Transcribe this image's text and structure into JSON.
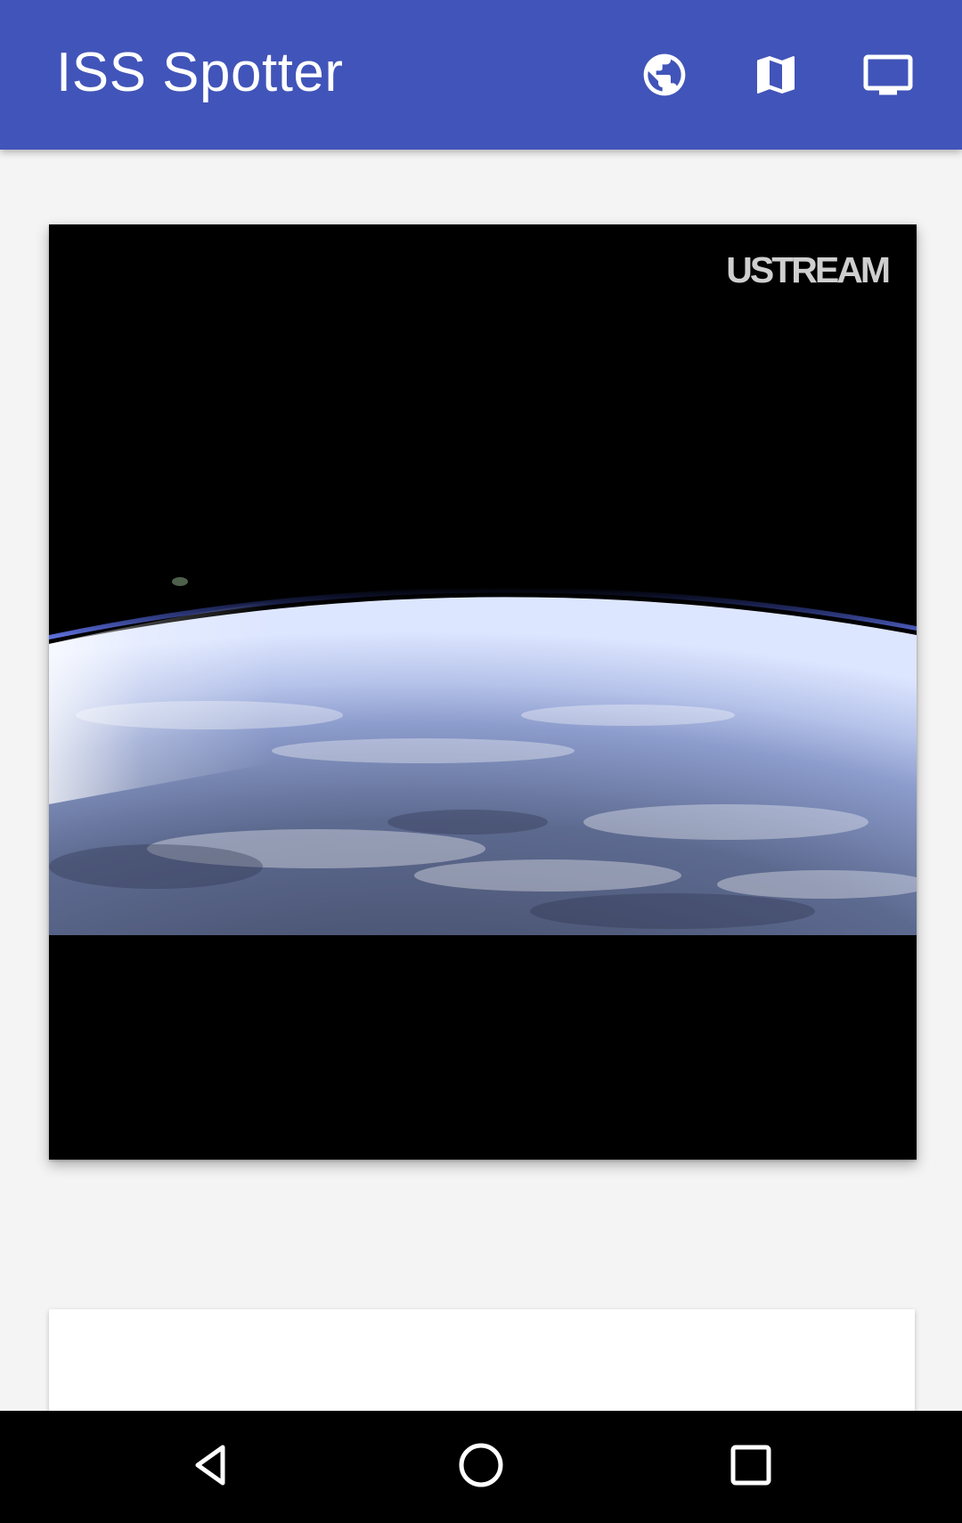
{
  "app_bar": {
    "title": "ISS Spotter",
    "background": "#4154b9",
    "actions": [
      {
        "icon": "globe-icon"
      },
      {
        "icon": "map-icon"
      },
      {
        "icon": "tv-icon"
      }
    ]
  },
  "video": {
    "watermark": "USTREAM"
  },
  "navigation_bar": {
    "buttons": [
      {
        "icon": "back-triangle-icon"
      },
      {
        "icon": "home-circle-icon"
      },
      {
        "icon": "recents-square-icon"
      }
    ]
  }
}
